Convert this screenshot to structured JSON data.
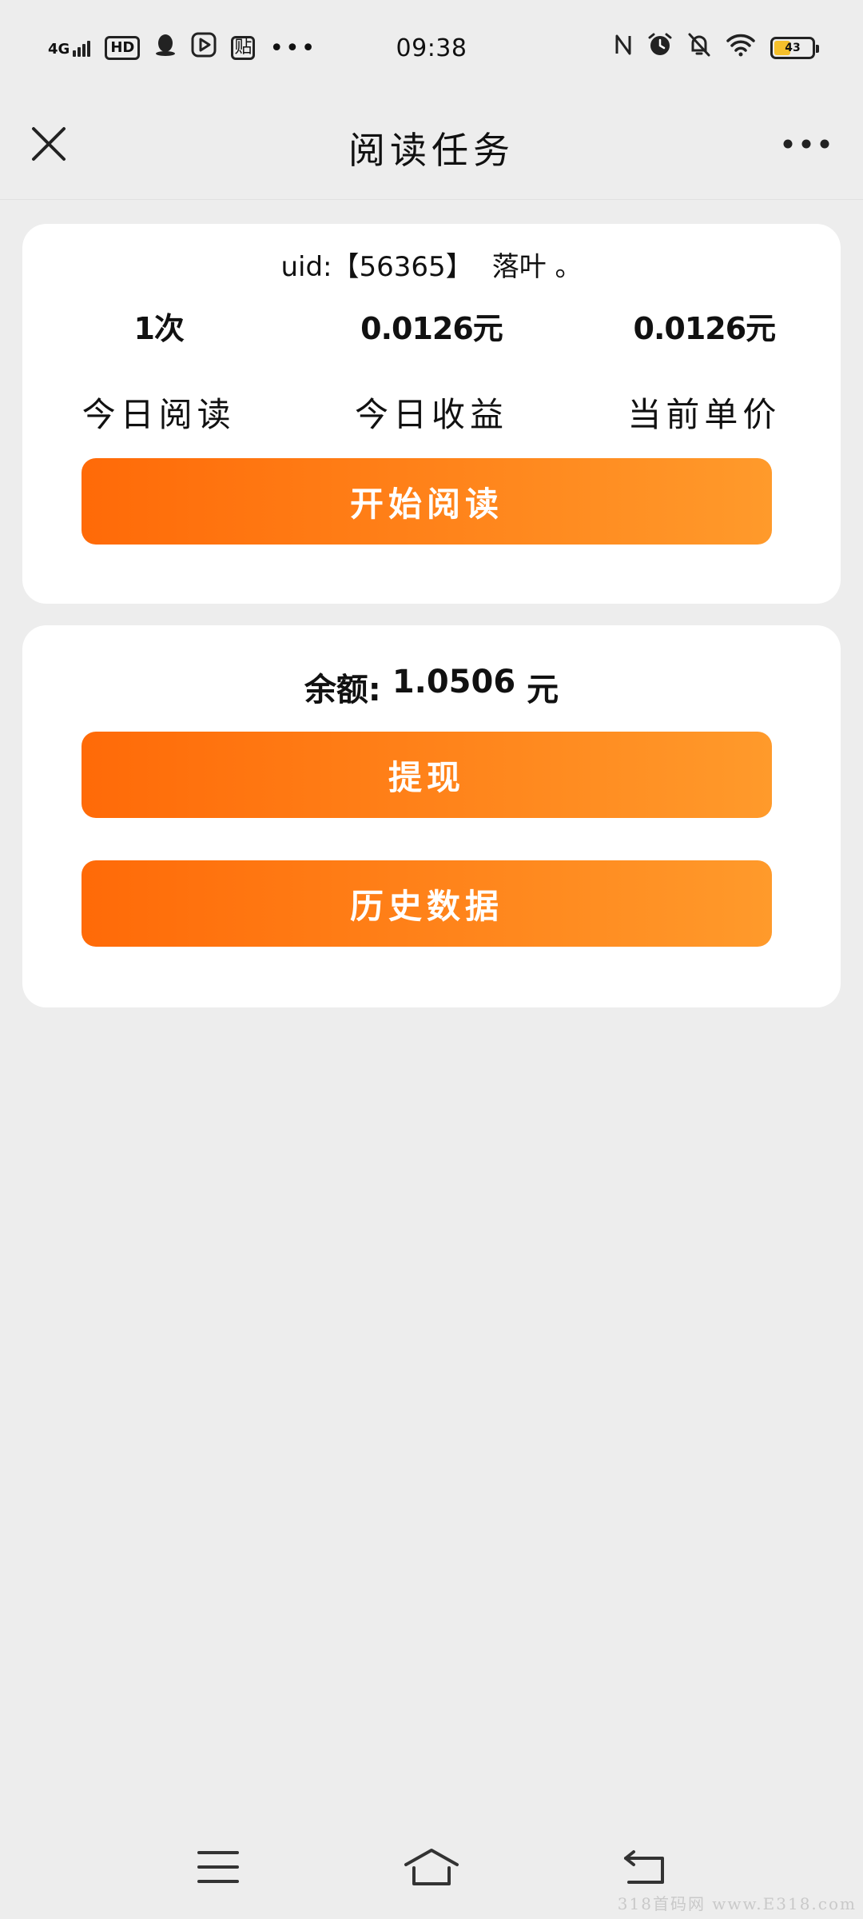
{
  "status_bar": {
    "network": "4G",
    "hd_label": "HD",
    "tie_label": "贴",
    "more_label": "•••",
    "time": "09:38",
    "battery_percent": "43",
    "battery_fill": 0.43
  },
  "header": {
    "title": "阅读任务"
  },
  "card_reading": {
    "uid_label": "uid:",
    "uid_value": "【56365】",
    "nickname": "落叶 。",
    "stats": [
      {
        "value": "1次",
        "label": "今日阅读"
      },
      {
        "value": "0.0126元",
        "label": "今日收益"
      },
      {
        "value": "0.0126元",
        "label": "当前单价"
      }
    ],
    "start_button": "开始阅读"
  },
  "card_balance": {
    "balance_label": "余额:",
    "balance_value": "1.0506",
    "balance_unit": "元",
    "withdraw_button": "提现",
    "history_button": "历史数据"
  },
  "colors": {
    "accent_start": "#ff6a08",
    "accent_end": "#ff9a2b",
    "background": "#ededed",
    "card": "#ffffff"
  },
  "watermark": "318首码网 www.E318.com"
}
